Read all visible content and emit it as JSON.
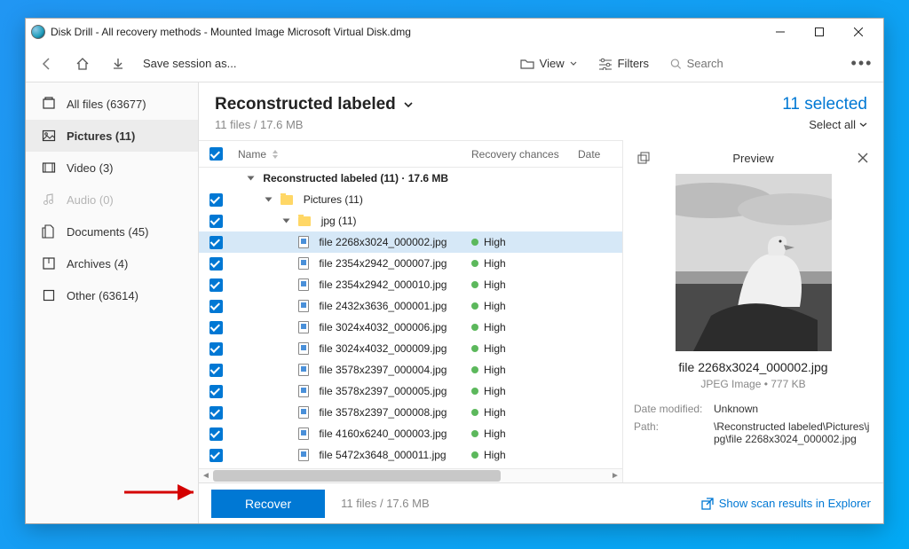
{
  "window": {
    "title": "Disk Drill - All recovery methods - Mounted Image Microsoft Virtual Disk.dmg"
  },
  "toolbar": {
    "save_label": "Save session as...",
    "view_label": "View",
    "filters_label": "Filters",
    "search_placeholder": "Search"
  },
  "sidebar": {
    "items": [
      {
        "label": "All files (63677)"
      },
      {
        "label": "Pictures (11)"
      },
      {
        "label": "Video (3)"
      },
      {
        "label": "Audio (0)"
      },
      {
        "label": "Documents (45)"
      },
      {
        "label": "Archives (4)"
      },
      {
        "label": "Other (63614)"
      }
    ]
  },
  "main": {
    "title": "Reconstructed labeled",
    "subtitle": "11 files / 17.6 MB",
    "selected_text": "11 selected",
    "selectall_text": "Select all"
  },
  "columns": {
    "name": "Name",
    "recovery": "Recovery chances",
    "date": "Date"
  },
  "rows": {
    "group_root": "Reconstructed labeled (11) · 17.6 MB",
    "group_pictures": "Pictures (11)",
    "group_jpg": "jpg (11)",
    "files": [
      {
        "name": "file 2268x3024_000002.jpg",
        "rec": "High",
        "selected": true
      },
      {
        "name": "file 2354x2942_000007.jpg",
        "rec": "High"
      },
      {
        "name": "file 2354x2942_000010.jpg",
        "rec": "High"
      },
      {
        "name": "file 2432x3636_000001.jpg",
        "rec": "High"
      },
      {
        "name": "file 3024x4032_000006.jpg",
        "rec": "High"
      },
      {
        "name": "file 3024x4032_000009.jpg",
        "rec": "High"
      },
      {
        "name": "file 3578x2397_000004.jpg",
        "rec": "High"
      },
      {
        "name": "file 3578x2397_000005.jpg",
        "rec": "High"
      },
      {
        "name": "file 3578x2397_000008.jpg",
        "rec": "High"
      },
      {
        "name": "file 4160x6240_000003.jpg",
        "rec": "High"
      },
      {
        "name": "file 5472x3648_000011.jpg",
        "rec": "High"
      }
    ]
  },
  "preview": {
    "title": "Preview",
    "filename": "file 2268x3024_000002.jpg",
    "type_line": "JPEG Image • 777 KB",
    "date_modified_k": "Date modified:",
    "date_modified_v": "Unknown",
    "path_k": "Path:",
    "path_v": "\\Reconstructed labeled\\Pictures\\jpg\\file 2268x3024_000002.jpg"
  },
  "footer": {
    "recover": "Recover",
    "info": "11 files / 17.6 MB",
    "link": "Show scan results in Explorer"
  }
}
